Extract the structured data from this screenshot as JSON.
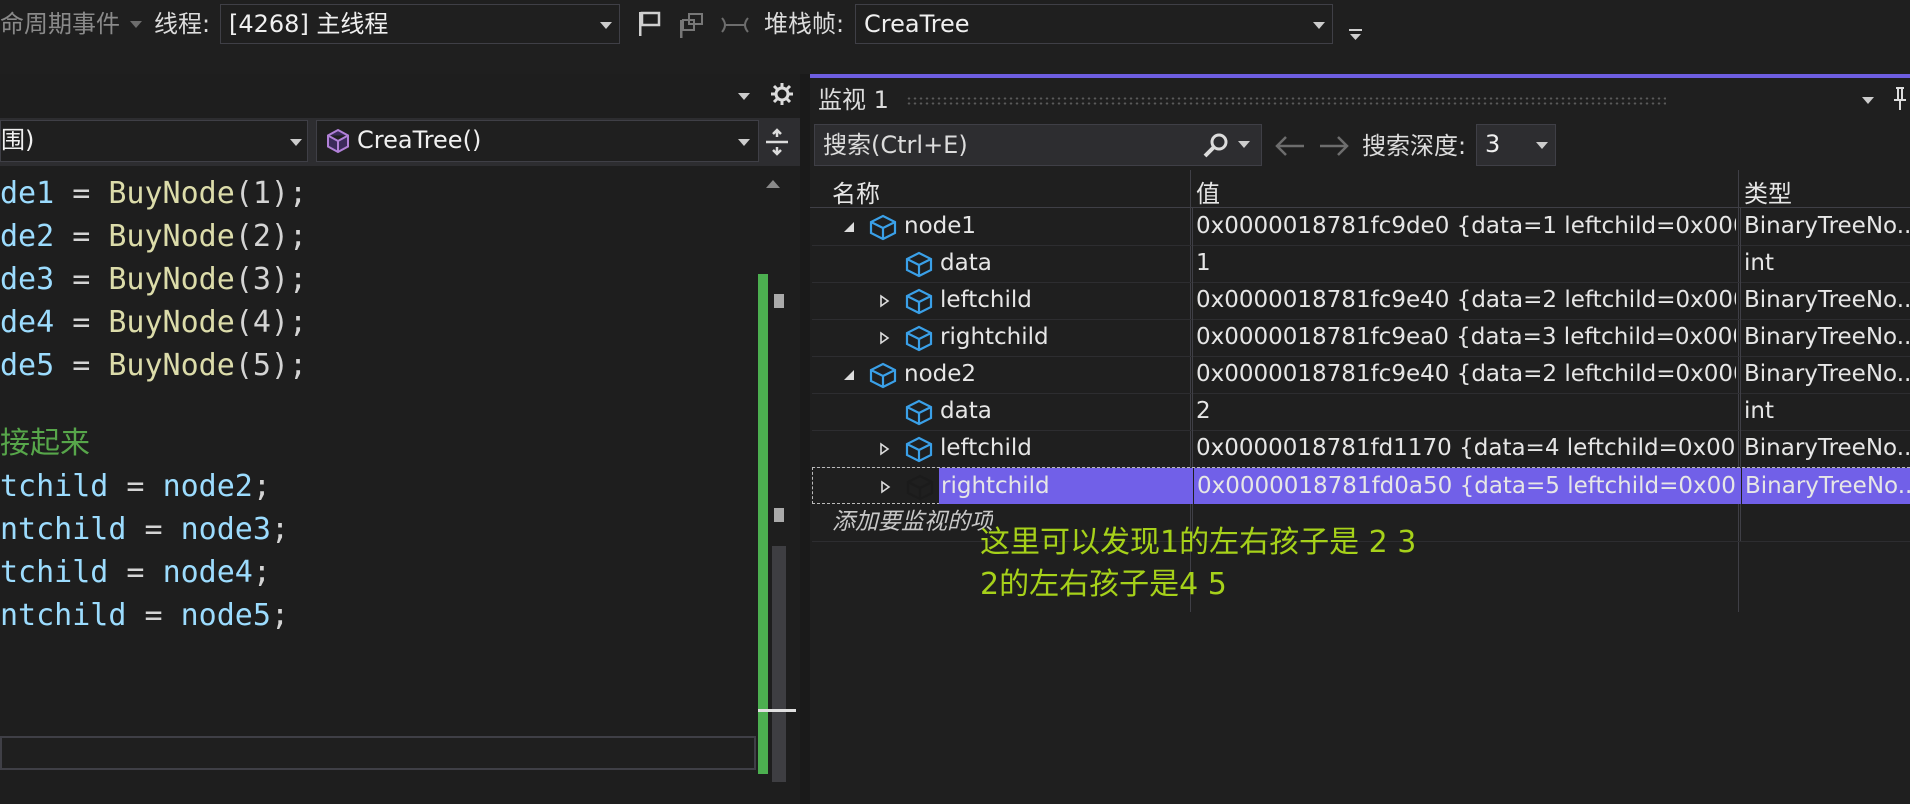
{
  "toolbar": {
    "lifecycle_label": "命周期事件",
    "thread_label": "线程:",
    "thread_value": "[4268] 主线程",
    "stackframe_label": "堆栈帧:",
    "stackframe_value": "CreaTree"
  },
  "editor": {
    "scope_combo": "围)",
    "function_combo": "CreaTree()",
    "lines": [
      {
        "var": "de1",
        "op": " = ",
        "fn": "BuyNode",
        "arg": "(1);"
      },
      {
        "var": "de2",
        "op": " = ",
        "fn": "BuyNode",
        "arg": "(2);"
      },
      {
        "var": "de3",
        "op": " = ",
        "fn": "BuyNode",
        "arg": "(3);"
      },
      {
        "var": "de4",
        "op": " = ",
        "fn": "BuyNode",
        "arg": "(4);"
      },
      {
        "var": "de5",
        "op": " = ",
        "fn": "BuyNode",
        "arg": "(5);"
      }
    ],
    "comment": "接起来",
    "assign_lines": [
      {
        "lhs": "tchild",
        "rhs": "node2"
      },
      {
        "lhs": "ntchild",
        "rhs": "node3"
      },
      {
        "lhs": "tchild",
        "rhs": "node4"
      },
      {
        "lhs": "ntchild",
        "rhs": "node5"
      }
    ]
  },
  "watch": {
    "title": "监视 1",
    "search_placeholder": "搜索(Ctrl+E)",
    "depth_label": "搜索深度:",
    "depth_value": "3",
    "columns": {
      "name": "名称",
      "value": "值",
      "type": "类型"
    },
    "rows": [
      {
        "name": "node1",
        "value": "0x0000018781fc9de0 {data=1 leftchild=0x000...",
        "type": "BinaryTreeNo..."
      },
      {
        "name": "data",
        "value": "1",
        "type": "int"
      },
      {
        "name": "leftchild",
        "value": "0x0000018781fc9e40 {data=2 leftchild=0x000...",
        "type": "BinaryTreeNo..."
      },
      {
        "name": "rightchild",
        "value": "0x0000018781fc9ea0 {data=3 leftchild=0x000...",
        "type": "BinaryTreeNo..."
      },
      {
        "name": "node2",
        "value": "0x0000018781fc9e40 {data=2 leftchild=0x000...",
        "type": "BinaryTreeNo..."
      },
      {
        "name": "data",
        "value": "2",
        "type": "int"
      },
      {
        "name": "leftchild",
        "value": "0x0000018781fd1170 {data=4 leftchild=0x00...",
        "type": "BinaryTreeNo..."
      },
      {
        "name": "rightchild",
        "value": "0x0000018781fd0a50 {data=5 leftchild=0x00...",
        "type": "BinaryTreeNo..."
      }
    ],
    "add_item": "添加要监视的项"
  },
  "annotation": {
    "line1": "这里可以发现1的左右孩子是 2 3",
    "line2": "2的左右孩子是4 5"
  },
  "colors": {
    "selection": "#7160e8",
    "annotation": "#a6d11a",
    "accent": "#6e5ee0"
  }
}
